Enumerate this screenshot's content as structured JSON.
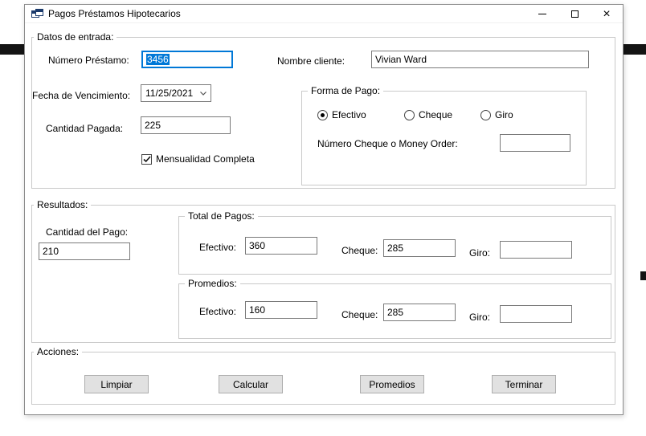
{
  "window": {
    "title": "Pagos Préstamos Hipotecarios",
    "controls": {
      "close_glyph": "×"
    }
  },
  "datos_entrada": {
    "legend": "Datos de entrada:",
    "numero_prestamo": {
      "label": "Número Préstamo:",
      "value": "3456",
      "selected": true
    },
    "nombre_cliente": {
      "label": "Nombre cliente:",
      "value": "Vivian Ward"
    },
    "fecha_vencimiento": {
      "label": "Fecha de Vencimiento:",
      "value": "11/25/2021"
    },
    "cantidad_pagada": {
      "label": "Cantidad Pagada:",
      "value": "225"
    },
    "mensualidad_completa": {
      "label": "Mensualidad Completa",
      "checked": true
    },
    "forma_pago": {
      "legend": "Forma de Pago:",
      "options": [
        {
          "label": "Efectivo",
          "selected": true
        },
        {
          "label": "Cheque",
          "selected": false
        },
        {
          "label": "Giro",
          "selected": false
        }
      ],
      "numero_cheque": {
        "label": "Número Cheque o Money Order:",
        "value": ""
      }
    }
  },
  "resultados": {
    "legend": "Resultados:",
    "cantidad_pago": {
      "label": "Cantidad del Pago:",
      "value": "210"
    },
    "total_pagos": {
      "legend": "Total de Pagos:",
      "efectivo": {
        "label": "Efectivo:",
        "value": "360"
      },
      "cheque": {
        "label": "Cheque:",
        "value": "285"
      },
      "giro": {
        "label": "Giro:",
        "value": ""
      }
    },
    "promedios": {
      "legend": "Promedios:",
      "efectivo": {
        "label": "Efectivo:",
        "value": "160"
      },
      "cheque": {
        "label": "Cheque:",
        "value": "285"
      },
      "giro": {
        "label": "Giro:",
        "value": ""
      }
    }
  },
  "acciones": {
    "legend": "Acciones:",
    "buttons": [
      {
        "label": "Limpiar"
      },
      {
        "label": "Calcular"
      },
      {
        "label": "Promedios"
      },
      {
        "label": "Terminar"
      }
    ]
  },
  "colors": {
    "accent": "#0078d7",
    "selection": "#0078d7"
  }
}
